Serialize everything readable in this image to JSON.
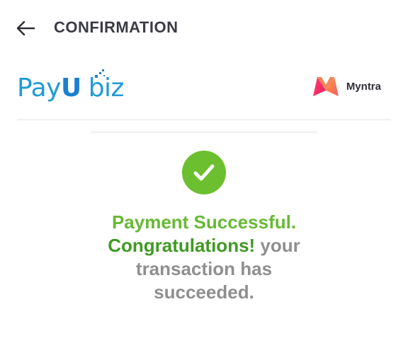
{
  "header": {
    "title": "CONFIRMATION"
  },
  "brand": {
    "gateway_name_part1": "Pay",
    "gateway_name_u": "U",
    "gateway_name_part2": "biz",
    "merchant_name": "Myntra"
  },
  "status": {
    "line1": "Payment Successful.",
    "congrats": "Congratulations!",
    "line2_rest": " your",
    "line3": "transaction has",
    "line4": "succeeded."
  },
  "colors": {
    "success_green": "#67b934",
    "success_circle": "#6cbf2e",
    "payu_blue": "#1f9bd7",
    "text_gray": "#8f8f8f"
  },
  "icons": {
    "back": "arrow-left-icon",
    "success": "check-circle-icon",
    "merchant_logo": "myntra-logo-icon"
  }
}
